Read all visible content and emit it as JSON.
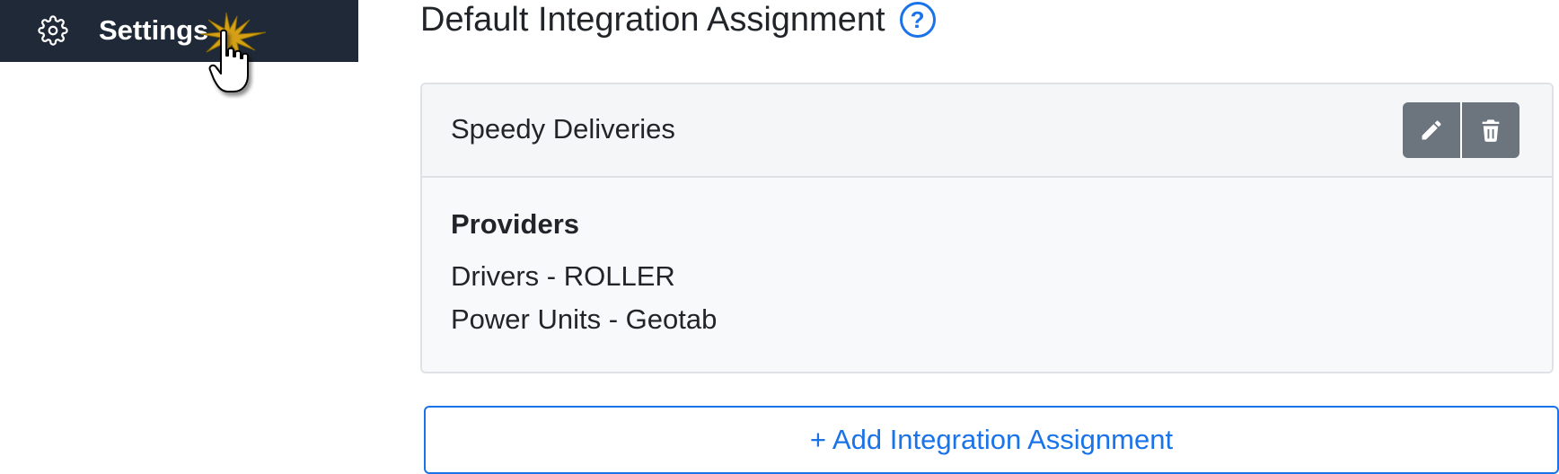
{
  "sidebar": {
    "settings_label": "Settings",
    "settings_icon": "gear-icon"
  },
  "main": {
    "title": "Default Integration Assignment",
    "help_glyph": "?",
    "help_icon": "question-circle-icon"
  },
  "assignment_card": {
    "name": "Speedy Deliveries",
    "actions": [
      {
        "icon": "pencil-icon"
      },
      {
        "icon": "trash-icon"
      }
    ],
    "providers_heading": "Providers",
    "providers": [
      "Drivers - ROLLER",
      "Power Units - Geotab"
    ]
  },
  "add_button_label": "+ Add Integration Assignment",
  "colors": {
    "sidebar_bg": "#1f2937",
    "accent": "#1a73e8",
    "button_secondary": "#6c757d",
    "card_bg": "#f8f9fa",
    "cursor_burst": "#d4a017"
  }
}
